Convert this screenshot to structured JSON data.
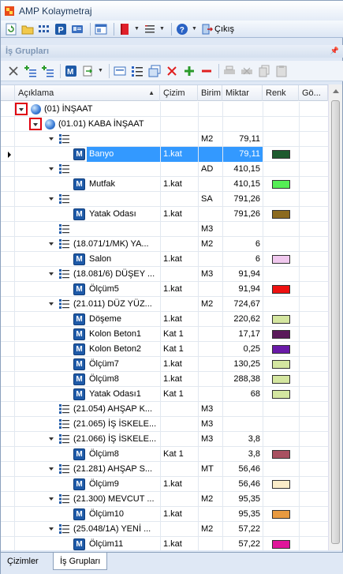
{
  "window": {
    "title": "AMP Kolaymetraj"
  },
  "toolbar": {
    "exit_label": "Çıkış"
  },
  "panel": {
    "title": "İş Grupları"
  },
  "columns": {
    "desc": "Açıklama",
    "cizim": "Çizim",
    "birim": "Birim",
    "miktar": "Miktar",
    "renk": "Renk",
    "go": "Gö..."
  },
  "tabs": [
    {
      "label": "Çizimler"
    },
    {
      "label": "İş Grupları"
    }
  ],
  "rows": [
    {
      "desc": "(01) İNŞAAT",
      "cizim": "",
      "birim": "",
      "miktar": ""
    },
    {
      "desc": "(01.01) KABA İNŞAAT",
      "cizim": "",
      "birim": "",
      "miktar": ""
    },
    {
      "desc": "",
      "cizim": "",
      "birim": "M2",
      "miktar": "79,11"
    },
    {
      "desc": "Banyo",
      "cizim": "1.kat",
      "birim": "",
      "miktar": "79,11",
      "color": "#1e5a2e"
    },
    {
      "desc": "",
      "cizim": "",
      "birim": "AD",
      "miktar": "410,15"
    },
    {
      "desc": "Mutfak",
      "cizim": "1.kat",
      "birim": "",
      "miktar": "410,15",
      "color": "#55ee55"
    },
    {
      "desc": "",
      "cizim": "",
      "birim": "SA",
      "miktar": "791,26"
    },
    {
      "desc": "Yatak Odası",
      "cizim": "1.kat",
      "birim": "",
      "miktar": "791,26",
      "color": "#8b6a1f"
    },
    {
      "desc": "",
      "cizim": "",
      "birim": "M3",
      "miktar": ""
    },
    {
      "desc": "(18.071/1/MK) YA...",
      "cizim": "",
      "birim": "M2",
      "miktar": "6"
    },
    {
      "desc": "Salon",
      "cizim": "1.kat",
      "birim": "",
      "miktar": "6",
      "color": "#f0c8ee"
    },
    {
      "desc": "(18.081/6) DÜŞEY ...",
      "cizim": "",
      "birim": "M3",
      "miktar": "91,94"
    },
    {
      "desc": "Ölçüm5",
      "cizim": "1.kat",
      "birim": "",
      "miktar": "91,94",
      "color": "#ee1111"
    },
    {
      "desc": "(21.011) DÜZ YÜZ...",
      "cizim": "",
      "birim": "M2",
      "miktar": "724,67"
    },
    {
      "desc": "Döşeme",
      "cizim": "1.kat",
      "birim": "",
      "miktar": "220,62",
      "color": "#d4e6a0"
    },
    {
      "desc": "Kolon Beton1",
      "cizim": "Kat 1",
      "birim": "",
      "miktar": "17,17",
      "color": "#5a1a5a"
    },
    {
      "desc": "Kolon Beton2",
      "cizim": "Kat 1",
      "birim": "",
      "miktar": "0,25",
      "color": "#6a1aa8"
    },
    {
      "desc": "Ölçüm7",
      "cizim": "1.kat",
      "birim": "",
      "miktar": "130,25",
      "color": "#d4e6a0"
    },
    {
      "desc": "Ölçüm8",
      "cizim": "1.kat",
      "birim": "",
      "miktar": "288,38",
      "color": "#d4e6a0"
    },
    {
      "desc": "Yatak Odası1",
      "cizim": "Kat 1",
      "birim": "",
      "miktar": "68",
      "color": "#d4e6a0"
    },
    {
      "desc": "(21.054) AHŞAP K...",
      "cizim": "",
      "birim": "M3",
      "miktar": ""
    },
    {
      "desc": "(21.065) İŞ İSKELE...",
      "cizim": "",
      "birim": "M3",
      "miktar": ""
    },
    {
      "desc": "(21.066) İŞ İSKELE...",
      "cizim": "",
      "birim": "M3",
      "miktar": "3,8"
    },
    {
      "desc": "Ölçüm8",
      "cizim": "Kat 1",
      "birim": "",
      "miktar": "3,8",
      "color": "#a85060"
    },
    {
      "desc": "(21.281) AHŞAP S...",
      "cizim": "",
      "birim": "MT",
      "miktar": "56,46"
    },
    {
      "desc": "Ölçüm9",
      "cizim": "1.kat",
      "birim": "",
      "miktar": "56,46",
      "color": "#faecc8"
    },
    {
      "desc": "(21.300) MEVCUT ...",
      "cizim": "",
      "birim": "M2",
      "miktar": "95,35"
    },
    {
      "desc": "Ölçüm10",
      "cizim": "1.kat",
      "birim": "",
      "miktar": "95,35",
      "color": "#e89a40"
    },
    {
      "desc": "(25.048/1A) YENİ ...",
      "cizim": "",
      "birim": "M2",
      "miktar": "57,22"
    },
    {
      "desc": "Ölçüm11",
      "cizim": "1.kat",
      "birim": "",
      "miktar": "57,22",
      "color": "#e0169a"
    }
  ]
}
